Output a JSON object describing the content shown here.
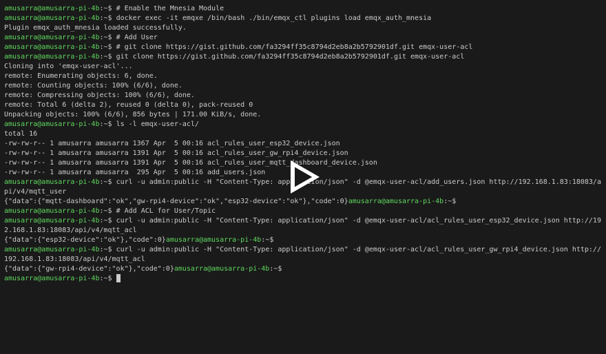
{
  "prompt": {
    "userhost": "amusarra@amusarra-pi-4b",
    "sep": ":~$ "
  },
  "lines": [
    {
      "t": "prompt",
      "text": "# Enable the Mnesia Module"
    },
    {
      "t": "prompt",
      "text": "docker exec -it emqxe /bin/bash ./bin/emqx_ctl plugins load emqx_auth_mnesia"
    },
    {
      "t": "out",
      "text": "Plugin emqx_auth_mnesia loaded successfully."
    },
    {
      "t": "prompt",
      "text": "# Add User"
    },
    {
      "t": "prompt",
      "text": "# git clone https://gist.github.com/fa3294ff35c8794d2eb8a2b5792901df.git emqx-user-acl"
    },
    {
      "t": "prompt",
      "text": "git clone https://gist.github.com/fa3294ff35c8794d2eb8a2b5792901df.git emqx-user-acl"
    },
    {
      "t": "out",
      "text": "Cloning into 'emqx-user-acl'..."
    },
    {
      "t": "out",
      "text": "remote: Enumerating objects: 6, done."
    },
    {
      "t": "out",
      "text": "remote: Counting objects: 100% (6/6), done."
    },
    {
      "t": "out",
      "text": "remote: Compressing objects: 100% (6/6), done."
    },
    {
      "t": "out",
      "text": "remote: Total 6 (delta 2), reused 0 (delta 0), pack-reused 0"
    },
    {
      "t": "out",
      "text": "Unpacking objects: 100% (6/6), 856 bytes | 171.00 KiB/s, done."
    },
    {
      "t": "prompt",
      "text": "ls -l emqx-user-acl/"
    },
    {
      "t": "out",
      "text": "total 16"
    },
    {
      "t": "out",
      "text": "-rw-rw-r-- 1 amusarra amusarra 1367 Apr  5 00:16 acl_rules_user_esp32_device.json"
    },
    {
      "t": "out",
      "text": "-rw-rw-r-- 1 amusarra amusarra 1391 Apr  5 00:16 acl_rules_user_gw_rpi4_device.json"
    },
    {
      "t": "out",
      "text": "-rw-rw-r-- 1 amusarra amusarra 1391 Apr  5 00:16 acl_rules_user_mqtt_dashboard_device.json"
    },
    {
      "t": "out",
      "text": "-rw-rw-r-- 1 amusarra amusarra  295 Apr  5 00:16 add_users.json"
    },
    {
      "t": "prompt",
      "text": "curl -u admin:public -H \"Content-Type: application/json\" -d @emqx-user-acl/add_users.json http://192.168.1.83:18083/api/v4/mqtt_user"
    },
    {
      "t": "out-prompt",
      "out": "{\"data\":{\"mqtt-dashboard\":\"ok\",\"gw-rpi4-device\":\"ok\",\"esp32-device\":\"ok\"},\"code\":0}",
      "text": ""
    },
    {
      "t": "prompt",
      "text": "# Add ACL for User/Topic"
    },
    {
      "t": "prompt",
      "text": "curl -u admin:public -H \"Content-Type: application/json\" -d @emqx-user-acl/acl_rules_user_esp32_device.json http://192.168.1.83:18083/api/v4/mqtt_acl"
    },
    {
      "t": "out-prompt",
      "out": "{\"data\":{\"esp32-device\":\"ok\"},\"code\":0}",
      "text": ""
    },
    {
      "t": "prompt",
      "text": "curl -u admin:public -H \"Content-Type: application/json\" -d @emqx-user-acl/acl_rules_user_gw_rpi4_device.json http://192.168.1.83:18083/api/v4/mqtt_acl"
    },
    {
      "t": "out-prompt",
      "out": "{\"data\":{\"gw-rpi4-device\":\"ok\"},\"code\":0}",
      "text": ""
    },
    {
      "t": "prompt-cursor",
      "text": ""
    }
  ],
  "play": {
    "label": "play"
  }
}
